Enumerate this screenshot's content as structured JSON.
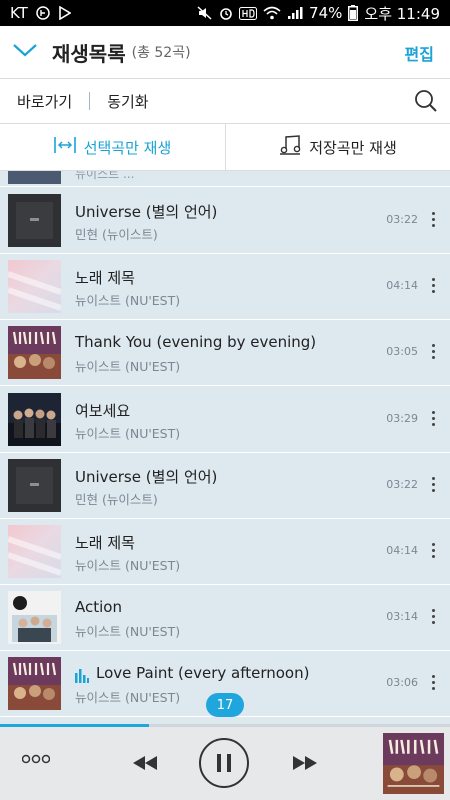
{
  "status_bar": {
    "carrier": "KT",
    "battery": "74%",
    "time": "오후 11:49"
  },
  "header": {
    "title": "재생목록",
    "count": "(총 52곡)",
    "edit_label": "편집"
  },
  "shortcuts": {
    "goto_label": "바로가기",
    "sync_label": "동기화"
  },
  "modes": {
    "selected_only_label": "선택곡만 재생",
    "saved_only_label": "저장곡만 재생"
  },
  "partial_row": {
    "song": "뉴이스트 ..."
  },
  "songs": [
    {
      "title": "Universe (별의 언어)",
      "artist": "민현 (뉴이스트)",
      "duration": "03:22",
      "art": "dark"
    },
    {
      "title": "노래 제목",
      "artist": "뉴이스트 (NU'EST)",
      "duration": "04:14",
      "art": "pink"
    },
    {
      "title": "Thank You (evening by evening)",
      "artist": "뉴이스트 (NU'EST)",
      "duration": "03:05",
      "art": "nuest"
    },
    {
      "title": "여보세요",
      "artist": "뉴이스트 (NU'EST)",
      "duration": "03:29",
      "art": "group"
    },
    {
      "title": "Universe (별의 언어)",
      "artist": "민현 (뉴이스트)",
      "duration": "03:22",
      "art": "dark"
    },
    {
      "title": "노래 제목",
      "artist": "뉴이스트 (NU'EST)",
      "duration": "04:14",
      "art": "pink"
    },
    {
      "title": "Action",
      "artist": "뉴이스트 (NU'EST)",
      "duration": "03:14",
      "art": "action"
    },
    {
      "title": "Love Paint (every afternoon)",
      "artist": "뉴이스트 (NU'EST)",
      "duration": "03:06",
      "art": "nuest",
      "playing": true
    }
  ],
  "page_indicator": "17",
  "player": {
    "progress": 0.33,
    "more_icon": "more-horizontal-icon",
    "prev_icon": "rewind-icon",
    "pause_icon": "pause-icon",
    "next_icon": "fast-forward-icon"
  },
  "colors": {
    "accent": "#1aa3d6",
    "list_bg": "#dde8ef"
  }
}
